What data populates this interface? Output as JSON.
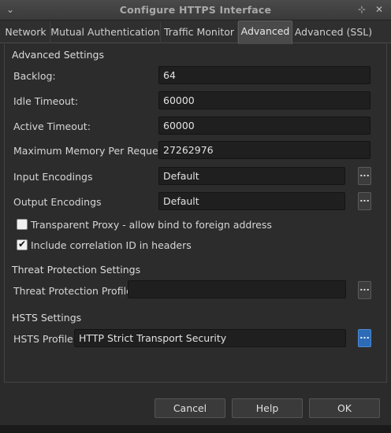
{
  "window": {
    "title": "Configure HTTPS Interface",
    "icon_left": "chevron-down-icon",
    "icon_pin": "pin-icon",
    "icon_close": "close-icon"
  },
  "tabs": [
    {
      "label": "Network",
      "active": false
    },
    {
      "label": "Mutual Authentication",
      "active": false
    },
    {
      "label": "Traffic Monitor",
      "active": false
    },
    {
      "label": "Advanced",
      "active": true
    },
    {
      "label": "Advanced (SSL)",
      "active": false
    }
  ],
  "advanced": {
    "heading": "Advanced Settings",
    "backlog": {
      "label": "Backlog:",
      "value": "64"
    },
    "idle_timeout": {
      "label": "Idle Timeout:",
      "value": "60000"
    },
    "active_timeout": {
      "label": "Active Timeout:",
      "value": "60000"
    },
    "max_memory": {
      "label": "Maximum Memory Per Request:",
      "value": "27262976"
    },
    "input_encodings": {
      "label": "Input Encodings",
      "value": "Default",
      "button": "..."
    },
    "output_encodings": {
      "label": "Output Encodings",
      "value": "Default",
      "button": "..."
    },
    "transparent_proxy": {
      "label": "Transparent Proxy - allow bind to foreign address",
      "checked": false
    },
    "correlation_id": {
      "label": "Include correlation ID in headers",
      "checked": true
    }
  },
  "threat": {
    "heading": "Threat Protection Settings",
    "profile": {
      "label": "Threat Protection Profile:",
      "value": "",
      "button": "..."
    }
  },
  "hsts": {
    "heading": "HSTS Settings",
    "profile": {
      "label": "HSTS Profile:",
      "value": "HTTP Strict Transport Security",
      "button": "..."
    }
  },
  "buttons": {
    "cancel": "Cancel",
    "help": "Help",
    "ok": "OK"
  },
  "colors": {
    "accent": "#2d6bb7",
    "background": "#2b2b2b",
    "field": "#1f1f1f"
  }
}
